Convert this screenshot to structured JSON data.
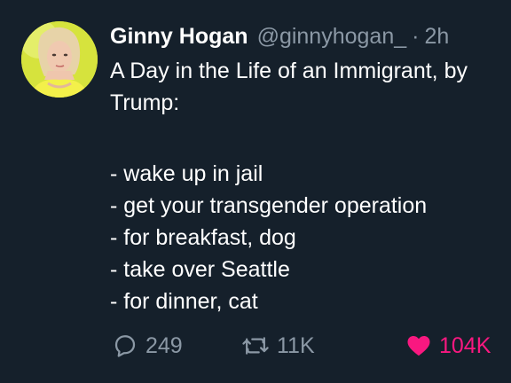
{
  "user": {
    "display_name": "Ginny Hogan",
    "handle": "@ginnyhogan_",
    "separator": "·",
    "time": "2h",
    "avatar_icon": "profile-photo"
  },
  "tweet": {
    "lines": [
      "A Day in the Life of an Immigrant, by",
      "Trump:",
      "- wake up in jail",
      "- get your transgender operation",
      "- for breakfast, dog",
      "- take over Seattle",
      "- for dinner, cat"
    ]
  },
  "actions": {
    "reply_count": "249",
    "retweet_count": "11K",
    "like_count": "104K",
    "reply_icon": "reply-icon",
    "retweet_icon": "retweet-icon",
    "like_icon": "heart-icon",
    "like_color": "#f91880",
    "muted_color": "#8b98a5"
  },
  "theme": {
    "background": "#15202b",
    "text": "#ffffff"
  }
}
